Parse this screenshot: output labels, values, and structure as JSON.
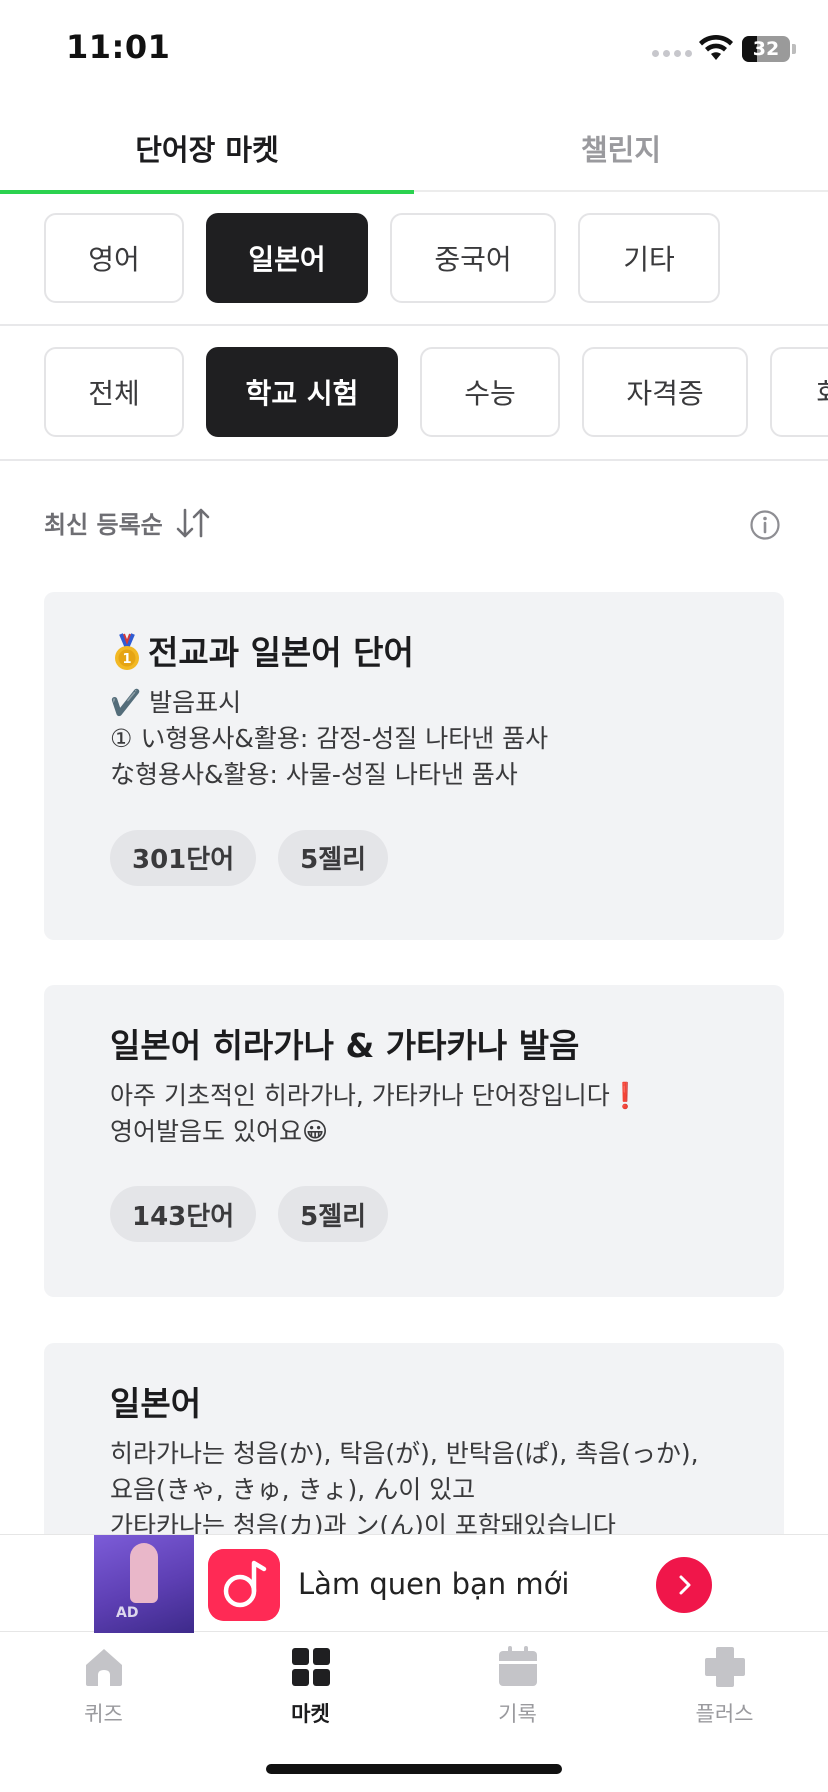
{
  "status_bar": {
    "time": "11:01",
    "battery": "32"
  },
  "top_tabs": [
    {
      "label": "단어장 마켓",
      "active": true
    },
    {
      "label": "챌린지",
      "active": false
    }
  ],
  "language_chips": [
    {
      "label": "영어",
      "selected": false
    },
    {
      "label": "일본어",
      "selected": true
    },
    {
      "label": "중국어",
      "selected": false
    },
    {
      "label": "기타",
      "selected": false
    }
  ],
  "category_chips": [
    {
      "label": "전체",
      "selected": false
    },
    {
      "label": "학교 시험",
      "selected": true
    },
    {
      "label": "수능",
      "selected": false
    },
    {
      "label": "자격증",
      "selected": false
    },
    {
      "label": "회",
      "selected": false
    }
  ],
  "sort": {
    "label": "최신 등록순"
  },
  "cards": [
    {
      "title": "전교과 일본어 단어",
      "desc": "✔️ 발음표시\n① い형용사&활용: 감정-성질 나타낸 품사\n    な형용사&활용: 사물-성질 나타낸 품사",
      "words": "301단어",
      "price": "5젤리"
    },
    {
      "title": "일본어 히라가나 & 가타카나 발음",
      "desc": "아주 기초적인 히라가나, 가타카나 단어장입니다❗️\n영어발음도 있어요😀",
      "words": "143단어",
      "price": "5젤리"
    },
    {
      "title": "일본어",
      "desc": "히라가나는 청음(か), 탁음(が), 반탁음(ぱ), 촉음(っか), 요음(きゃ, きゅ, きょ), ん이 있고\n가타카나는 청음(カ)과 ン(ん)이 포함돼있습니다"
    }
  ],
  "ad": {
    "text": "Làm quen bạn mới",
    "thumb_label": "AD"
  },
  "bottom_nav": [
    {
      "label": "퀴즈",
      "icon": "home-icon",
      "active": false
    },
    {
      "label": "마켓",
      "icon": "grid-icon",
      "active": true
    },
    {
      "label": "기록",
      "icon": "calendar-icon",
      "active": false
    },
    {
      "label": "플러스",
      "icon": "plus-icon",
      "active": false
    }
  ],
  "colors": {
    "accent": "#2bd24f",
    "chip_selected": "#1f1f21",
    "card_bg": "#f2f3f5",
    "ad_button": "#f0164a"
  }
}
